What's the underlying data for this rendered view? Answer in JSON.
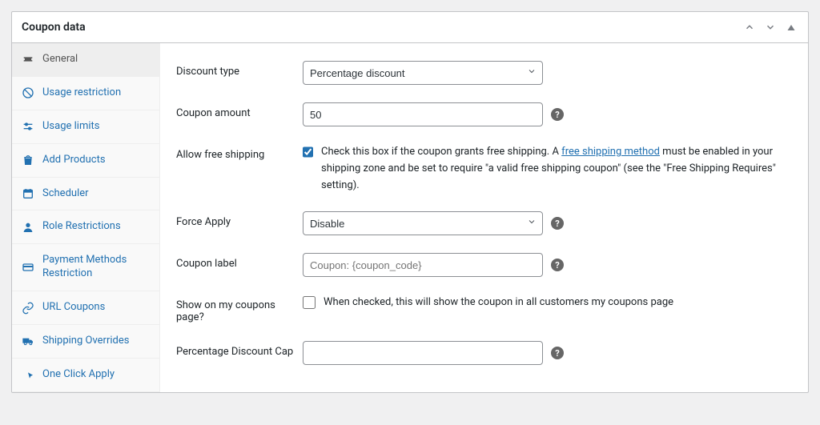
{
  "panel": {
    "title": "Coupon data"
  },
  "tabs": {
    "general": "General",
    "usage_restriction": "Usage restriction",
    "usage_limits": "Usage limits",
    "add_products": "Add Products",
    "scheduler": "Scheduler",
    "role_restrictions": "Role Restrictions",
    "payment_methods": "Payment Methods Restriction",
    "url_coupons": "URL Coupons",
    "shipping_overrides": "Shipping Overrides",
    "one_click_apply": "One Click Apply"
  },
  "fields": {
    "discount_type": {
      "label": "Discount type",
      "value": "Percentage discount"
    },
    "coupon_amount": {
      "label": "Coupon amount",
      "value": "50"
    },
    "allow_free_shipping": {
      "label": "Allow free shipping",
      "checked": true,
      "desc_before": "Check this box if the coupon grants free shipping. A ",
      "desc_link": "free shipping method",
      "desc_after": " must be enabled in your shipping zone and be set to require \"a valid free shipping coupon\" (see the \"Free Shipping Requires\" setting)."
    },
    "force_apply": {
      "label": "Force Apply",
      "value": "Disable"
    },
    "coupon_label": {
      "label": "Coupon label",
      "placeholder": "Coupon: {coupon_code}",
      "value": ""
    },
    "show_on_my_coupons": {
      "label": "Show on my coupons page?",
      "checked": false,
      "desc": "When checked, this will show the coupon in all customers my coupons page"
    },
    "percentage_cap": {
      "label": "Percentage Discount Cap",
      "value": ""
    }
  }
}
